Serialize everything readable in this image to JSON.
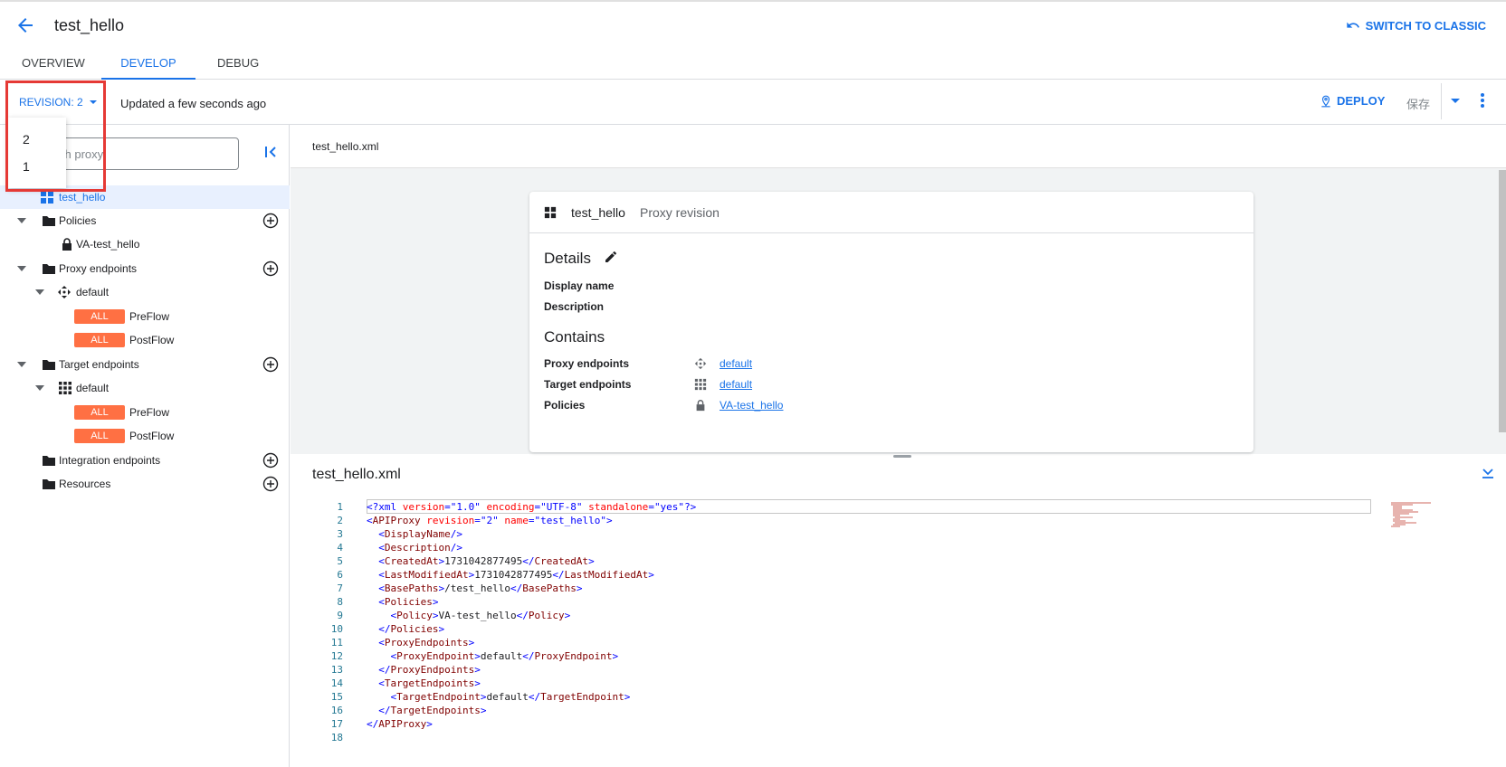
{
  "header": {
    "title": "test_hello",
    "switch_classic": "SWITCH TO CLASSIC"
  },
  "tabs": [
    {
      "label": "OVERVIEW"
    },
    {
      "label": "DEVELOP"
    },
    {
      "label": "DEBUG"
    }
  ],
  "toolbar": {
    "revision_label": "REVISION: 2",
    "updated": "Updated a few seconds ago",
    "deploy": "DEPLOY",
    "save": "保存"
  },
  "revision_menu": {
    "options": [
      "2",
      "1"
    ]
  },
  "sidebar": {
    "search_placeholder": "ch proxy",
    "tree": {
      "root": "test_hello",
      "policies": "Policies",
      "policy_item": "VA-test_hello",
      "proxy_endpoints": "Proxy endpoints",
      "proxy_default": "default",
      "all_badge": "ALL",
      "preflow": "PreFlow",
      "postflow": "PostFlow",
      "target_endpoints": "Target endpoints",
      "target_default": "default",
      "integration_endpoints": "Integration endpoints",
      "resources": "Resources"
    }
  },
  "main": {
    "file_tab": "test_hello.xml",
    "card": {
      "title": "test_hello",
      "subtitle": "Proxy revision",
      "details_heading": "Details",
      "display_name_label": "Display name",
      "description_label": "Description",
      "contains_heading": "Contains",
      "proxy_endpoints_label": "Proxy endpoints",
      "proxy_endpoints_link": "default",
      "target_endpoints_label": "Target endpoints",
      "target_endpoints_link": "default",
      "policies_label": "Policies",
      "policies_link": "VA-test_hello"
    },
    "editor_title": "test_hello.xml"
  },
  "editor": {
    "line_numbers": [
      "1",
      "2",
      "3",
      "4",
      "5",
      "6",
      "7",
      "8",
      "9",
      "10",
      "11",
      "12",
      "13",
      "14",
      "15",
      "16",
      "17",
      "18"
    ],
    "xml_decl": {
      "open": "<?xml",
      "version_attr": "version",
      "version_val": "\"1.0\"",
      "encoding_attr": "encoding",
      "encoding_val": "\"UTF-8\"",
      "standalone_attr": "standalone",
      "standalone_val": "\"yes\"",
      "close": "?>"
    },
    "apiproxy_open": {
      "tag": "APIProxy",
      "revision_attr": "revision",
      "revision_val": "\"2\"",
      "name_attr": "name",
      "name_val": "\"test_hello\""
    },
    "display_name_tag": "DisplayName",
    "description_tag": "Description",
    "created_at_tag": "CreatedAt",
    "created_at_val": "1731042877495",
    "last_modified_tag": "LastModifiedAt",
    "last_modified_val": "1731042877495",
    "base_paths_tag": "BasePaths",
    "base_paths_val": "/test_hello",
    "policies_tag": "Policies",
    "policy_tag": "Policy",
    "policy_val": "VA-test_hello",
    "proxy_endpoints_tag": "ProxyEndpoints",
    "proxy_endpoint_tag": "ProxyEndpoint",
    "proxy_endpoint_val": "default",
    "target_endpoints_tag": "TargetEndpoints",
    "target_endpoint_tag": "TargetEndpoint",
    "target_endpoint_val": "default",
    "apiproxy_tag": "APIProxy"
  },
  "colors": {
    "accent": "#1a73e8",
    "badge": "#ff7043",
    "highlight": "#e53935"
  }
}
